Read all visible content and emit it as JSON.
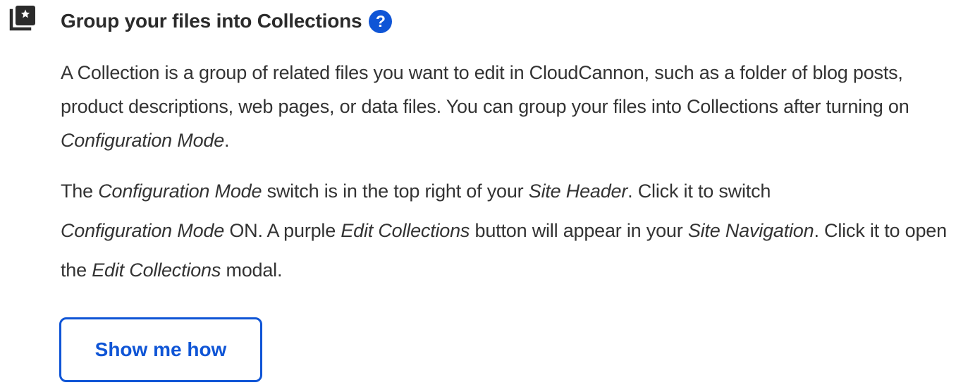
{
  "header": {
    "icon": "collections-star-icon",
    "title": "Group your files into Collections",
    "help_icon": "question-mark-icon",
    "help_glyph": "?"
  },
  "description": {
    "p1_text1": "A Collection is a group of related files you want to edit in CloudCannon, such as a folder of blog posts, product descriptions, web pages, or data files. You can group your files into Collections after turning on ",
    "p1_em1": "Configuration Mode",
    "p1_text2": ".",
    "p2_text1": "The ",
    "p2_em1": "Configuration Mode",
    "p2_text2": " switch is in the top right of your ",
    "p2_em2": "Site Header",
    "p2_text3": ". Click it to switch ",
    "p2_em3": "Configuration Mode",
    "p2_text4": " ON. A purple ",
    "p2_em4": "Edit Collections",
    "p2_text5": " button will appear in your ",
    "p2_em5": "Site Navigation",
    "p2_text6": ". Click it to open the ",
    "p2_em6": "Edit Collections",
    "p2_text7": " modal."
  },
  "cta": {
    "label": "Show me how"
  },
  "colors": {
    "accent": "#0f55d6",
    "text": "#333333",
    "icon": "#2b2b2b"
  }
}
